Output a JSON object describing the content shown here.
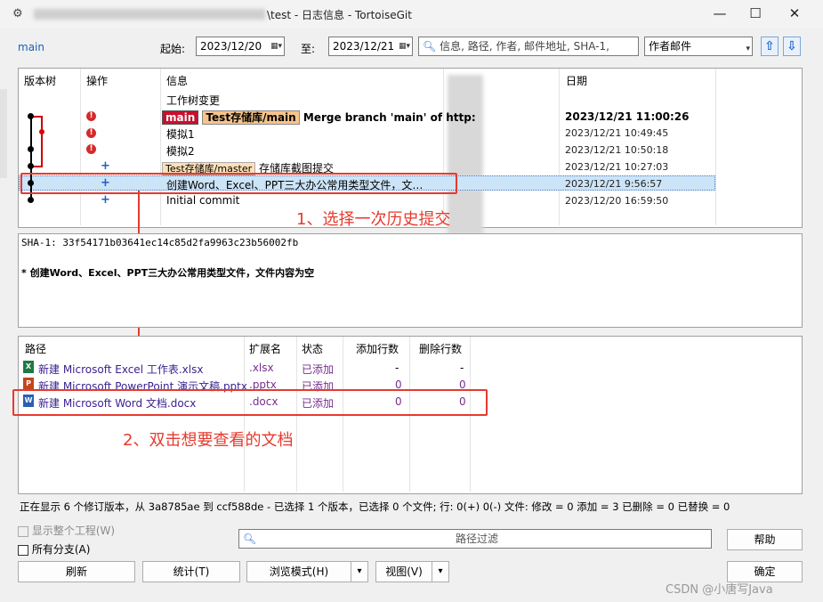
{
  "window": {
    "title_suffix": "\\test - 日志信息 - TortoiseGit",
    "minimize_glyph": "—",
    "maximize_glyph": "☐",
    "close_glyph": "✕"
  },
  "toolbar": {
    "branch": "main",
    "from_label": "起始:",
    "from_date": "2023/12/20",
    "to_label": "至:",
    "to_date": "2023/12/21",
    "search_placeholder": "信息, 路径, 作者, 邮件地址, SHA-1,",
    "filter_select": "作者邮件",
    "up_glyph": "⇧",
    "down_glyph": "⇩"
  },
  "log_table": {
    "headers": [
      "版本树",
      "操作",
      "信息",
      "",
      "日期"
    ],
    "rows": [
      {
        "message": "工作树变更",
        "date": ""
      },
      {
        "tags": [
          "main",
          "Test存储库/main"
        ],
        "message": "Merge branch 'main' of http:",
        "date": "2023/12/21 11:00:26"
      },
      {
        "message": "模拟1",
        "date": "2023/12/21 10:49:45"
      },
      {
        "message": "模拟2",
        "date": "2023/12/21 10:50:18"
      },
      {
        "tags": [
          "Test存储库/master"
        ],
        "message": "存储库截图提交",
        "date": "2023/12/21 10:27:03"
      },
      {
        "message": "创建Word、Excel、PPT三大办公常用类型文件，文…",
        "date": "2023/12/21 9:56:57"
      },
      {
        "message": "Initial commit",
        "date": "2023/12/20 16:59:50"
      }
    ]
  },
  "annotations": {
    "step1": "1、选择一次历史提交",
    "step2": "2、双击想要查看的文档"
  },
  "detail": {
    "sha": "SHA-1: 33f54171b03641ec14c85d2fa9963c23b56002fb",
    "message": "* 创建Word、Excel、PPT三大办公常用类型文件，文件内容为空"
  },
  "files_table": {
    "headers": [
      "路径",
      "扩展名",
      "状态",
      "添加行数",
      "删除行数"
    ],
    "rows": [
      {
        "icon": "X",
        "path": "新建 Microsoft Excel 工作表.xlsx",
        "ext": ".xlsx",
        "status": "已添加",
        "added": "-",
        "deleted": "-"
      },
      {
        "icon": "P",
        "path": "新建 Microsoft PowerPoint 演示文稿.pptx",
        "ext": ".pptx",
        "status": "已添加",
        "added": "0",
        "deleted": "0"
      },
      {
        "icon": "W",
        "path": "新建 Microsoft Word 文档.docx",
        "ext": ".docx",
        "status": "已添加",
        "added": "0",
        "deleted": "0"
      }
    ]
  },
  "status_bar": "正在显示 6 个修订版本，从 3a8785ae 到 ccf588de - 已选择 1 个版本，已选择 0 个文件; 行: 0(+) 0(-) 文件: 修改 = 0 添加 = 3 已删除 = 0 已替换 = 0",
  "bottom": {
    "show_whole_project": "显示整个工程(W)",
    "all_branches": "所有分支(A)",
    "path_filter_placeholder": "路径过滤",
    "help": "帮助",
    "refresh": "刷新",
    "stats": "统计(T)",
    "browse_mode": "浏览模式(H)",
    "view": "视图(V)",
    "ok": "确定",
    "watermark": "CSDN @小唐写Java"
  },
  "colors": {
    "annotation_red": "#e63a2e",
    "selection": "#cce4f7",
    "tag_main": "#c8102e",
    "tag_remote": "#f6c48b"
  }
}
